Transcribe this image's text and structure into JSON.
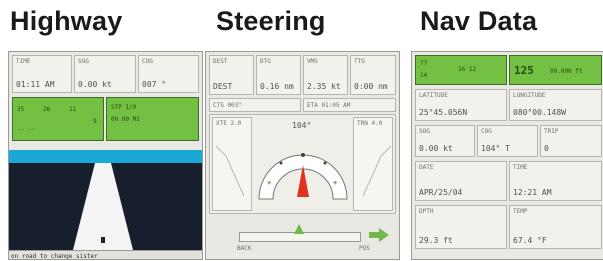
{
  "titles": {
    "highway": "Highway",
    "steering": "Steering",
    "nav": "Nav Data"
  },
  "highway": {
    "fields": [
      {
        "label": "TIME",
        "value": "01:11 AM"
      },
      {
        "label": "SOG",
        "value": "0.00 kt"
      },
      {
        "label": "COG",
        "value": "007 °"
      }
    ],
    "waypoint_left": [
      "35",
      "26",
      "11",
      "9"
    ],
    "waypoint_right": {
      "label": "STP 1/0",
      "text": "00.00 MI"
    },
    "message": "on road to change sister"
  },
  "steering": {
    "fields": [
      {
        "label": "DEST",
        "value": "DEST"
      },
      {
        "label": "DTG",
        "value": "0.16 nm"
      },
      {
        "label": "VMG",
        "value": "2.35 kt"
      },
      {
        "label": "TTG",
        "value": "0:00 nm"
      }
    ],
    "left_row": "CTS 003°",
    "right_row": "ETA 01:05 AM",
    "heading": "104°",
    "left_scale": "XTE 2.0",
    "right_scale": "TRN 4.0",
    "nav_btn_left": "BACK",
    "nav_btn_right": "POS"
  },
  "nav": {
    "top_left": [
      "77",
      "14",
      "26 12"
    ],
    "top_right": [
      "125",
      "00.000 ft"
    ],
    "fields": [
      {
        "label": "LATITUDE",
        "value": "25°45.056N"
      },
      {
        "label": "LONGITUDE",
        "value": "080°00.148W"
      },
      {
        "label": "SOG",
        "value": "0.00 kt"
      },
      {
        "label": "COG",
        "value": "104° T"
      },
      {
        "label": "TRIP",
        "value": "0"
      },
      {
        "label": "DATE",
        "value": "APR/25/04"
      },
      {
        "label": "TIME",
        "value": "12:21 AM"
      },
      {
        "label": "DPTH",
        "value": "29.3 ft"
      },
      {
        "label": "TEMP",
        "value": "67.4 °F"
      }
    ]
  }
}
